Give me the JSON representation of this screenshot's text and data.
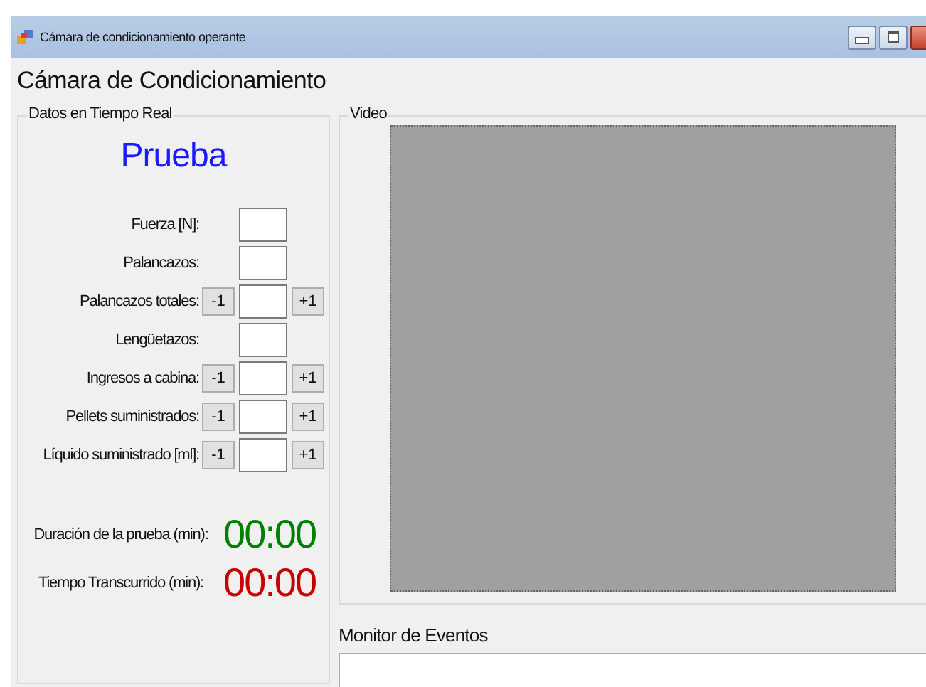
{
  "window": {
    "title": "Cámara de condicionamiento operante"
  },
  "heading": "Cámara de Condicionamiento",
  "realtime": {
    "title": "Datos en Tiempo Real",
    "mode": "Prueba",
    "rows": [
      {
        "label": "Fuerza [N]:",
        "kind": "display"
      },
      {
        "label": "Palancazos:",
        "kind": "display"
      },
      {
        "label": "Palancazos totales:",
        "kind": "counter",
        "minus": "-1",
        "plus": "+1"
      },
      {
        "label": "Lengüetazos:",
        "kind": "display"
      },
      {
        "label": "Ingresos a cabina:",
        "kind": "counter",
        "minus": "-1",
        "plus": "+1"
      },
      {
        "label": "Pellets suministrados:",
        "kind": "counter",
        "minus": "-1",
        "plus": "+1"
      },
      {
        "label": "Líquido suministrado [ml]:",
        "kind": "counter",
        "minus": "-1",
        "plus": "+1"
      }
    ],
    "timers": [
      {
        "label": "Duración de la prueba (min):",
        "value": "00:00",
        "color": "#008000"
      },
      {
        "label": "Tiempo Transcurrido (min):",
        "value": "00:00",
        "color": "#c80000"
      }
    ]
  },
  "video": {
    "title": "Video"
  },
  "events": {
    "title": "Monitor de Eventos"
  }
}
